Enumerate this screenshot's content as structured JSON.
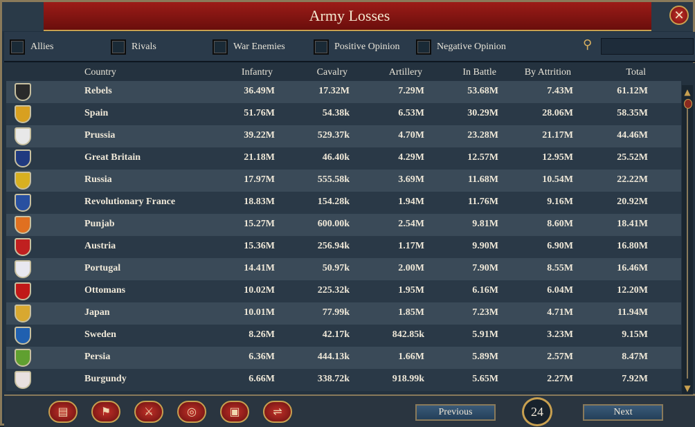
{
  "window": {
    "title": "Army Losses"
  },
  "filters": [
    {
      "label": "Allies"
    },
    {
      "label": "Rivals"
    },
    {
      "label": "War Enemies"
    },
    {
      "label": "Positive Opinion"
    },
    {
      "label": "Negative Opinion"
    }
  ],
  "search": {
    "value": ""
  },
  "columns": [
    "Country",
    "Infantry",
    "Cavalry",
    "Artillery",
    "In Battle",
    "By Attrition",
    "Total"
  ],
  "rows": [
    {
      "country": "Rebels",
      "infantry": "36.49M",
      "cavalry": "17.32M",
      "artillery": "7.29M",
      "in_battle": "53.68M",
      "by_attrition": "7.43M",
      "total": "61.12M",
      "flag_color": "#2a2a2a"
    },
    {
      "country": "Spain",
      "infantry": "51.76M",
      "cavalry": "54.38k",
      "artillery": "6.53M",
      "in_battle": "30.29M",
      "by_attrition": "28.06M",
      "total": "58.35M",
      "flag_color": "#d8a020"
    },
    {
      "country": "Prussia",
      "infantry": "39.22M",
      "cavalry": "529.37k",
      "artillery": "4.70M",
      "in_battle": "23.28M",
      "by_attrition": "21.17M",
      "total": "44.46M",
      "flag_color": "#e8e8e8"
    },
    {
      "country": "Great Britain",
      "infantry": "21.18M",
      "cavalry": "46.40k",
      "artillery": "4.29M",
      "in_battle": "12.57M",
      "by_attrition": "12.95M",
      "total": "25.52M",
      "flag_color": "#203a80"
    },
    {
      "country": "Russia",
      "infantry": "17.97M",
      "cavalry": "555.58k",
      "artillery": "3.69M",
      "in_battle": "11.68M",
      "by_attrition": "10.54M",
      "total": "22.22M",
      "flag_color": "#d8b020"
    },
    {
      "country": "Revolutionary France",
      "infantry": "18.83M",
      "cavalry": "154.28k",
      "artillery": "1.94M",
      "in_battle": "11.76M",
      "by_attrition": "9.16M",
      "total": "20.92M",
      "flag_color": "#2850a0"
    },
    {
      "country": "Punjab",
      "infantry": "15.27M",
      "cavalry": "600.00k",
      "artillery": "2.54M",
      "in_battle": "9.81M",
      "by_attrition": "8.60M",
      "total": "18.41M",
      "flag_color": "#e07020"
    },
    {
      "country": "Austria",
      "infantry": "15.36M",
      "cavalry": "256.94k",
      "artillery": "1.17M",
      "in_battle": "9.90M",
      "by_attrition": "6.90M",
      "total": "16.80M",
      "flag_color": "#c02020"
    },
    {
      "country": "Portugal",
      "infantry": "14.41M",
      "cavalry": "50.97k",
      "artillery": "2.00M",
      "in_battle": "7.90M",
      "by_attrition": "8.55M",
      "total": "16.46M",
      "flag_color": "#e8e8f0"
    },
    {
      "country": "Ottomans",
      "infantry": "10.02M",
      "cavalry": "225.32k",
      "artillery": "1.95M",
      "in_battle": "6.16M",
      "by_attrition": "6.04M",
      "total": "12.20M",
      "flag_color": "#c01818"
    },
    {
      "country": "Japan",
      "infantry": "10.01M",
      "cavalry": "77.99k",
      "artillery": "1.85M",
      "in_battle": "7.23M",
      "by_attrition": "4.71M",
      "total": "11.94M",
      "flag_color": "#d8a830"
    },
    {
      "country": "Sweden",
      "infantry": "8.26M",
      "cavalry": "42.17k",
      "artillery": "842.85k",
      "in_battle": "5.91M",
      "by_attrition": "3.23M",
      "total": "9.15M",
      "flag_color": "#2060b0"
    },
    {
      "country": "Persia",
      "infantry": "6.36M",
      "cavalry": "444.13k",
      "artillery": "1.66M",
      "in_battle": "5.89M",
      "by_attrition": "2.57M",
      "total": "8.47M",
      "flag_color": "#60a030"
    },
    {
      "country": "Burgundy",
      "infantry": "6.66M",
      "cavalry": "338.72k",
      "artillery": "918.99k",
      "in_battle": "5.65M",
      "by_attrition": "2.27M",
      "total": "7.92M",
      "flag_color": "#e8e0e0"
    }
  ],
  "bottom": {
    "previous_label": "Previous",
    "next_label": "Next",
    "page_number": "24",
    "icons": [
      "ledger-icon",
      "flag-icon",
      "crossed-swords-icon",
      "coins-icon",
      "trade-crate-icon",
      "handshake-icon"
    ]
  },
  "colors": {
    "title_red": "#8a1410",
    "gold": "#c8a050",
    "panel": "#24323f"
  }
}
